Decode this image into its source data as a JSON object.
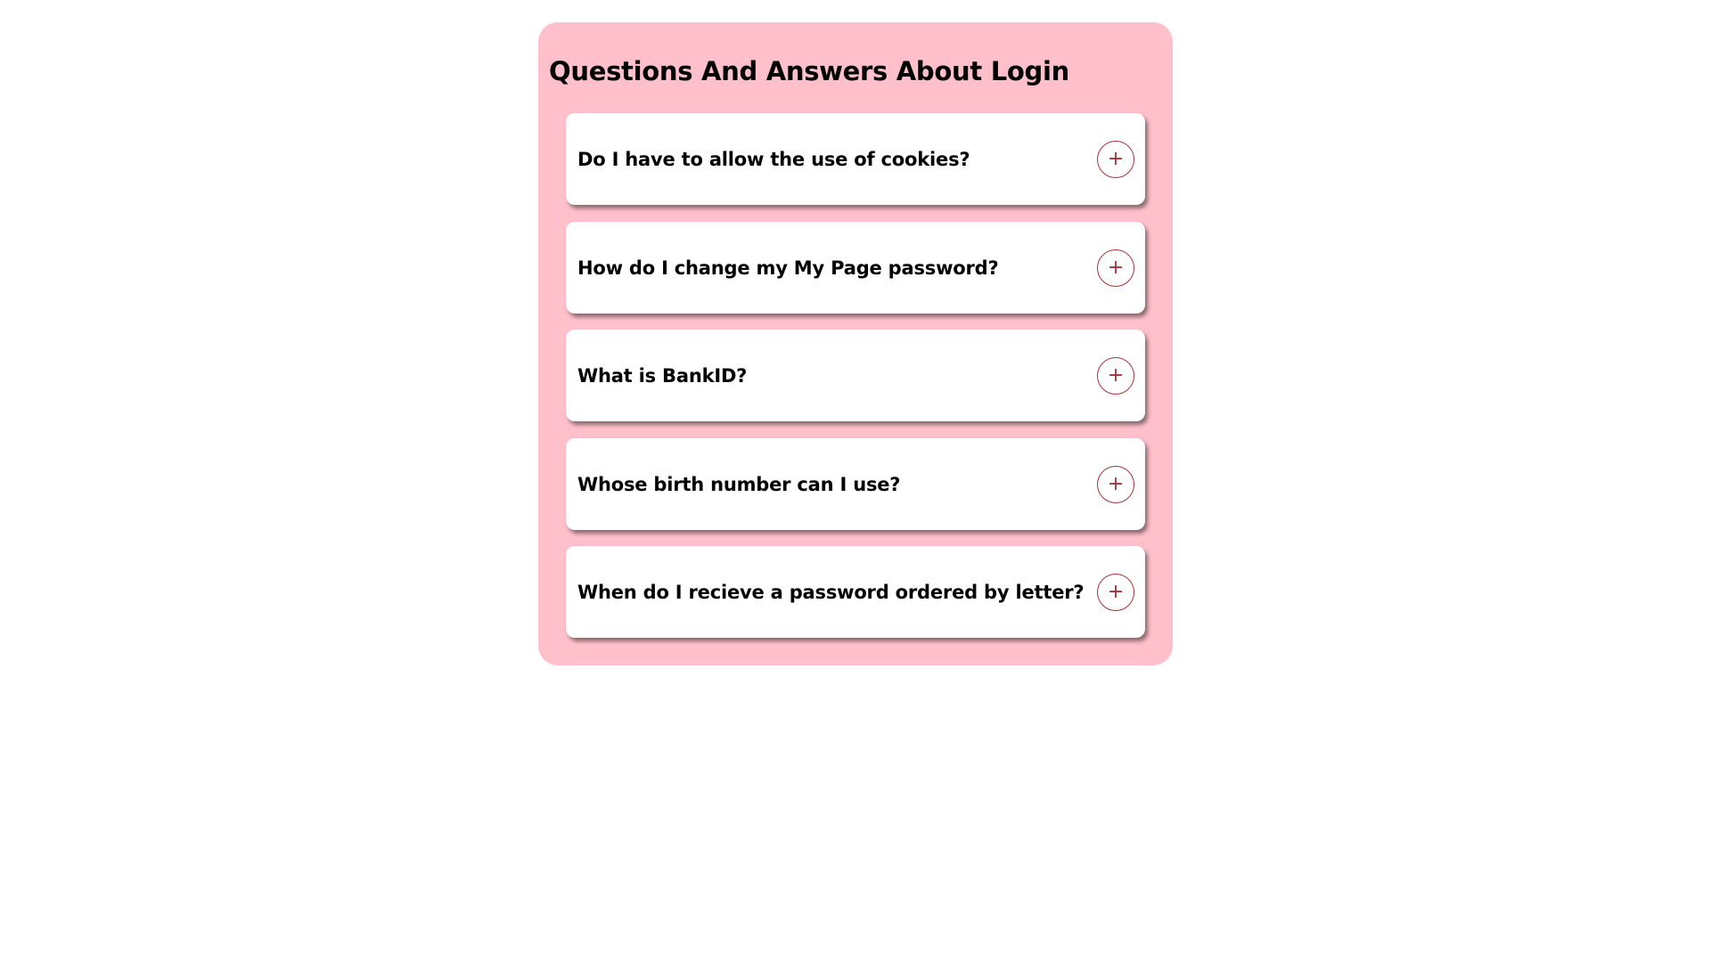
{
  "title": "Questions And Answers About Login",
  "items": [
    {
      "question": "Do I have to allow the use of cookies?",
      "icon": "+"
    },
    {
      "question": "How do I change my My Page password?",
      "icon": "+"
    },
    {
      "question": "What is BankID?",
      "icon": "+"
    },
    {
      "question": "Whose birth number can I use?",
      "icon": "+"
    },
    {
      "question": "When do I recieve a password ordered by letter?",
      "icon": "+"
    }
  ],
  "colors": {
    "panel": "#ffc0cb",
    "accent": "#a83238"
  }
}
